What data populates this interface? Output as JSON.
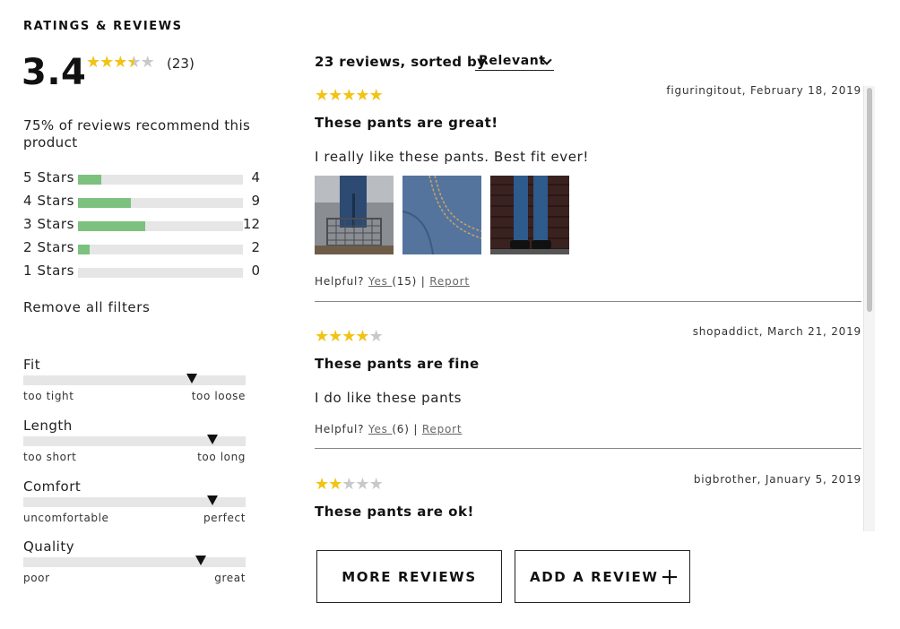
{
  "section_title": "RATINGS & REVIEWS",
  "summary": {
    "average": "3.4",
    "average_stars": 3.5,
    "count": "(23)",
    "recommend": "75% of reviews recommend this product"
  },
  "breakdown": [
    {
      "label": "5 Stars",
      "count": "4",
      "fraction": 0.14
    },
    {
      "label": "4 Stars",
      "count": "9",
      "fraction": 0.32
    },
    {
      "label": "3 Stars",
      "count": "12",
      "fraction": 0.41
    },
    {
      "label": "2 Stars",
      "count": "2",
      "fraction": 0.07
    },
    {
      "label": "1 Stars",
      "count": "0",
      "fraction": 0.0
    }
  ],
  "remove_filters": "Remove all filters",
  "characteristics": [
    {
      "name": "Fit",
      "low": "too tight",
      "high": "too loose",
      "value": 0.76
    },
    {
      "name": "Length",
      "low": "too short",
      "high": "too long",
      "value": 0.85
    },
    {
      "name": "Comfort",
      "low": "uncomfortable",
      "high": "perfect",
      "value": 0.85
    },
    {
      "name": "Quality",
      "low": "poor",
      "high": "great",
      "value": 0.8
    }
  ],
  "reviews_header": {
    "text": "23 reviews, sorted by",
    "sort_value": "Relevant"
  },
  "reviews": [
    {
      "stars": 5,
      "meta": "figuringitout, February 18, 2019",
      "title": "These pants are great!",
      "body": "I really like these pants. Best fit ever!",
      "helpful_label": "Helpful?",
      "yes": "Yes ",
      "yes_count": "(15)",
      "separator": "|",
      "report": "Report",
      "photos": [
        "jeans-cart-photo",
        "denim-closeup-photo",
        "jeans-wall-photo"
      ]
    },
    {
      "stars": 4,
      "meta": "shopaddict, March 21, 2019",
      "title": "These pants are fine",
      "body": "I do like these pants",
      "helpful_label": "Helpful?",
      "yes": "Yes ",
      "yes_count": "(6)",
      "separator": "|",
      "report": "Report"
    },
    {
      "stars": 2,
      "meta": "bigbrother, January 5, 2019",
      "title": "These pants are ok!"
    }
  ],
  "buttons": {
    "more": "MORE REVIEWS",
    "add": "ADD A REVIEW"
  },
  "colors": {
    "star_on": "#f2c314",
    "star_off": "#c8c8c8",
    "bar_fill": "#7cc17e",
    "bar_track": "#e6e6e6"
  }
}
